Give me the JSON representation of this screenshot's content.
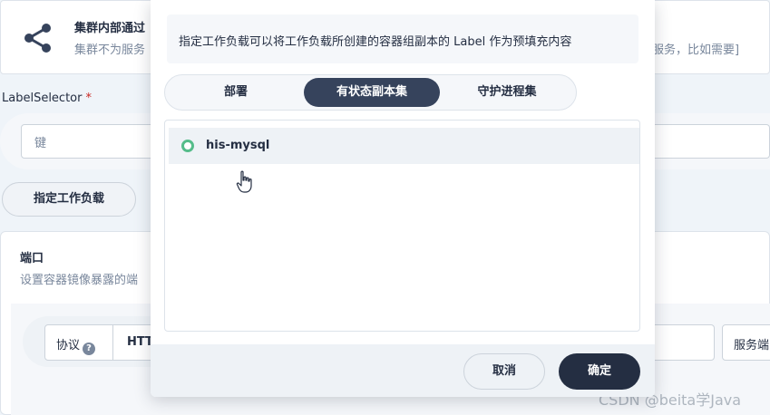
{
  "service_type": {
    "icon": "share-nodes-icon",
    "title": "集群内部通过",
    "description": "集群不为服务",
    "description_right": "的服务，比如需要]"
  },
  "label_selector": {
    "label": "LabelSelector",
    "required_mark": "*",
    "key_placeholder": "键"
  },
  "specify_workload_button": "指定工作负载",
  "ports": {
    "title": "端口",
    "description": "设置容器镜像暴露的端",
    "protocol_label": "协议",
    "help_icon": "?",
    "protocol_value": "HTT",
    "service_port_label": "服务端"
  },
  "popover": {
    "hint": "指定工作负载可以将工作负载所创建的容器组副本的 Label 作为预填充内容",
    "tabs": [
      "部署",
      "有状态副本集",
      "守护进程集"
    ],
    "active_tab": "有状态副本集",
    "workloads": [
      {
        "name": "his-mysql",
        "selected": false
      }
    ],
    "cancel_label": "取消",
    "confirm_label": "确定"
  },
  "watermark": "CSDN @beita学Java",
  "colors": {
    "active_tab": "#36435c",
    "confirm_button": "#242e42",
    "radio": "#55bc8a",
    "required": "#ca2621"
  }
}
